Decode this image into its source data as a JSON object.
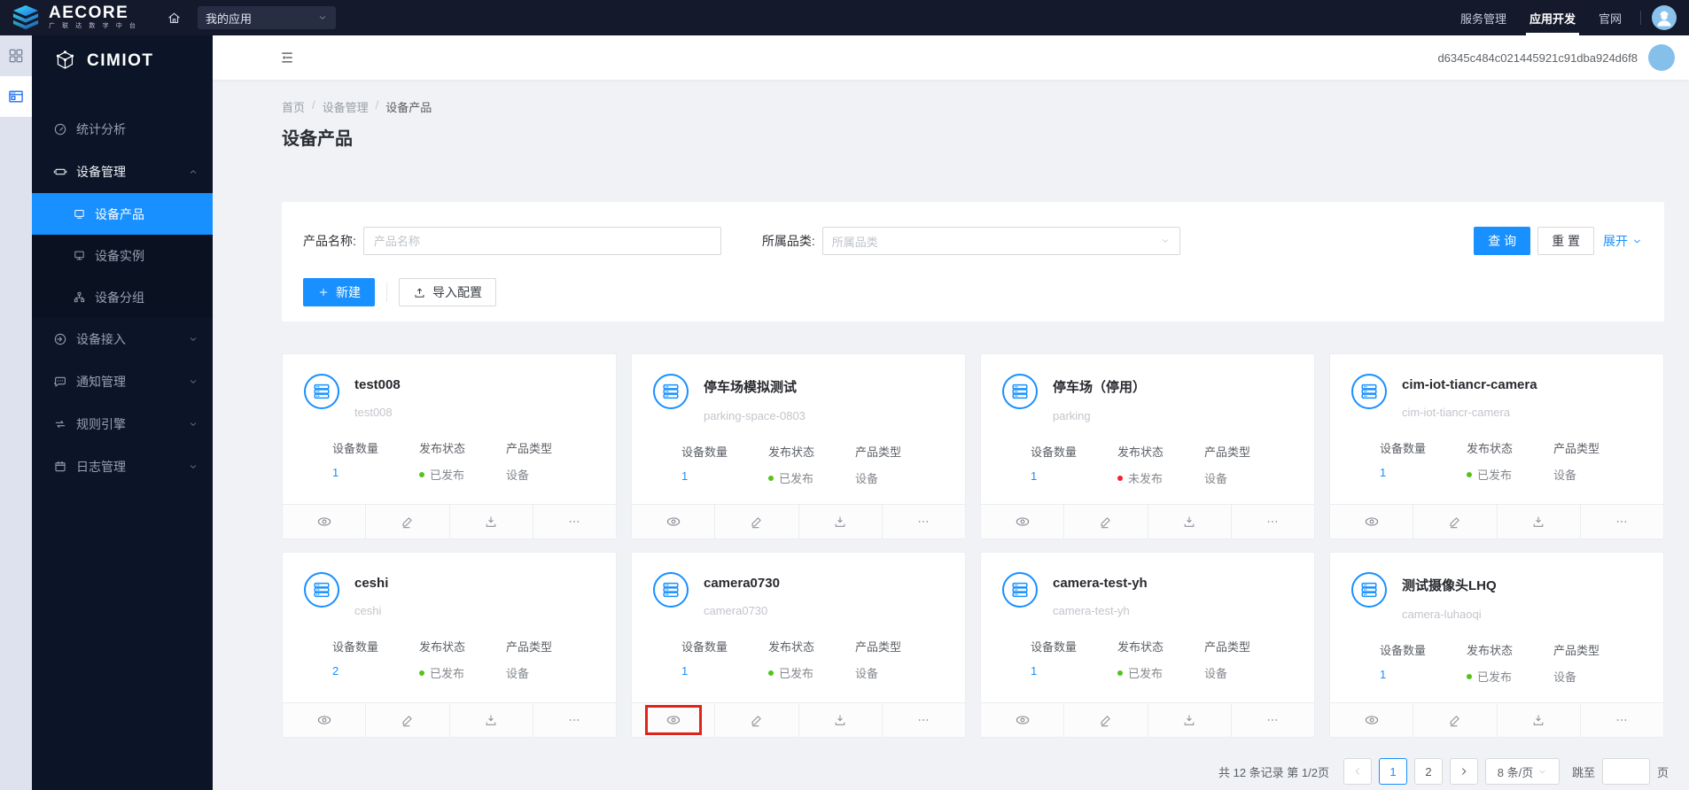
{
  "topbar": {
    "logo_title": "AECORE",
    "logo_subtitle": "广 联 达 数 字 中 台",
    "app_select_value": "我的应用",
    "nav": [
      {
        "label": "服务管理",
        "active": false
      },
      {
        "label": "应用开发",
        "active": true
      },
      {
        "label": "官网",
        "active": false
      }
    ]
  },
  "sidebar": {
    "logo": "CIMIOT",
    "items": [
      {
        "label": "统计分析",
        "icon": "gauge",
        "chevron": null
      },
      {
        "label": "设备管理",
        "icon": "devices",
        "chevron": "up",
        "expanded": true,
        "children": [
          {
            "label": "设备产品",
            "icon": "product",
            "active": true
          },
          {
            "label": "设备实例",
            "icon": "instance",
            "active": false
          },
          {
            "label": "设备分组",
            "icon": "group",
            "active": false
          }
        ]
      },
      {
        "label": "设备接入",
        "icon": "login",
        "chevron": "down"
      },
      {
        "label": "通知管理",
        "icon": "message",
        "chevron": "down"
      },
      {
        "label": "规则引擎",
        "icon": "loop",
        "chevron": "down"
      },
      {
        "label": "日志管理",
        "icon": "calendar",
        "chevron": "down"
      }
    ]
  },
  "header": {
    "token": "d6345c484c021445921c91dba924d6f8"
  },
  "breadcrumb": [
    "首页",
    "设备管理",
    "设备产品"
  ],
  "page": {
    "title": "设备产品"
  },
  "filters": {
    "name_label": "产品名称:",
    "name_placeholder": "产品名称",
    "category_label": "所属品类:",
    "category_placeholder": "所属品类",
    "search": "查 询",
    "reset": "重 置",
    "expand": "展开"
  },
  "actions": {
    "create": "新建",
    "import": "导入配置"
  },
  "card_labels": {
    "device_count": "设备数量",
    "publish_status": "发布状态",
    "product_type": "产品类型"
  },
  "status_text": {
    "published": "已发布",
    "unpublished": "未发布"
  },
  "products": [
    {
      "name": "test008",
      "code": "test008",
      "count": "1",
      "published": true,
      "type": "设备"
    },
    {
      "name": "停车场模拟测试",
      "code": "parking-space-0803",
      "count": "1",
      "published": true,
      "type": "设备"
    },
    {
      "name": "停车场（停用）",
      "code": "parking",
      "count": "1",
      "published": false,
      "type": "设备"
    },
    {
      "name": "cim-iot-tiancr-camera",
      "code": "cim-iot-tiancr-camera",
      "count": "1",
      "published": true,
      "type": "设备"
    },
    {
      "name": "ceshi",
      "code": "ceshi",
      "count": "2",
      "published": true,
      "type": "设备"
    },
    {
      "name": "camera0730",
      "code": "camera0730",
      "count": "1",
      "published": true,
      "type": "设备",
      "highlight_eye": true
    },
    {
      "name": "camera-test-yh",
      "code": "camera-test-yh",
      "count": "1",
      "published": true,
      "type": "设备"
    },
    {
      "name": "测试摄像头LHQ",
      "code": "camera-luhaoqi",
      "count": "1",
      "published": true,
      "type": "设备"
    }
  ],
  "pagination": {
    "summary": "共 12 条记录 第 1/2页",
    "pages": [
      "1",
      "2"
    ],
    "current": "1",
    "page_size": "8 条/页",
    "jump_label": "跳至",
    "jump_suffix": "页"
  },
  "colors": {
    "accent": "#1890ff",
    "published": "#52c41a",
    "unpublished": "#f5222d",
    "highlight": "#e0241b"
  }
}
